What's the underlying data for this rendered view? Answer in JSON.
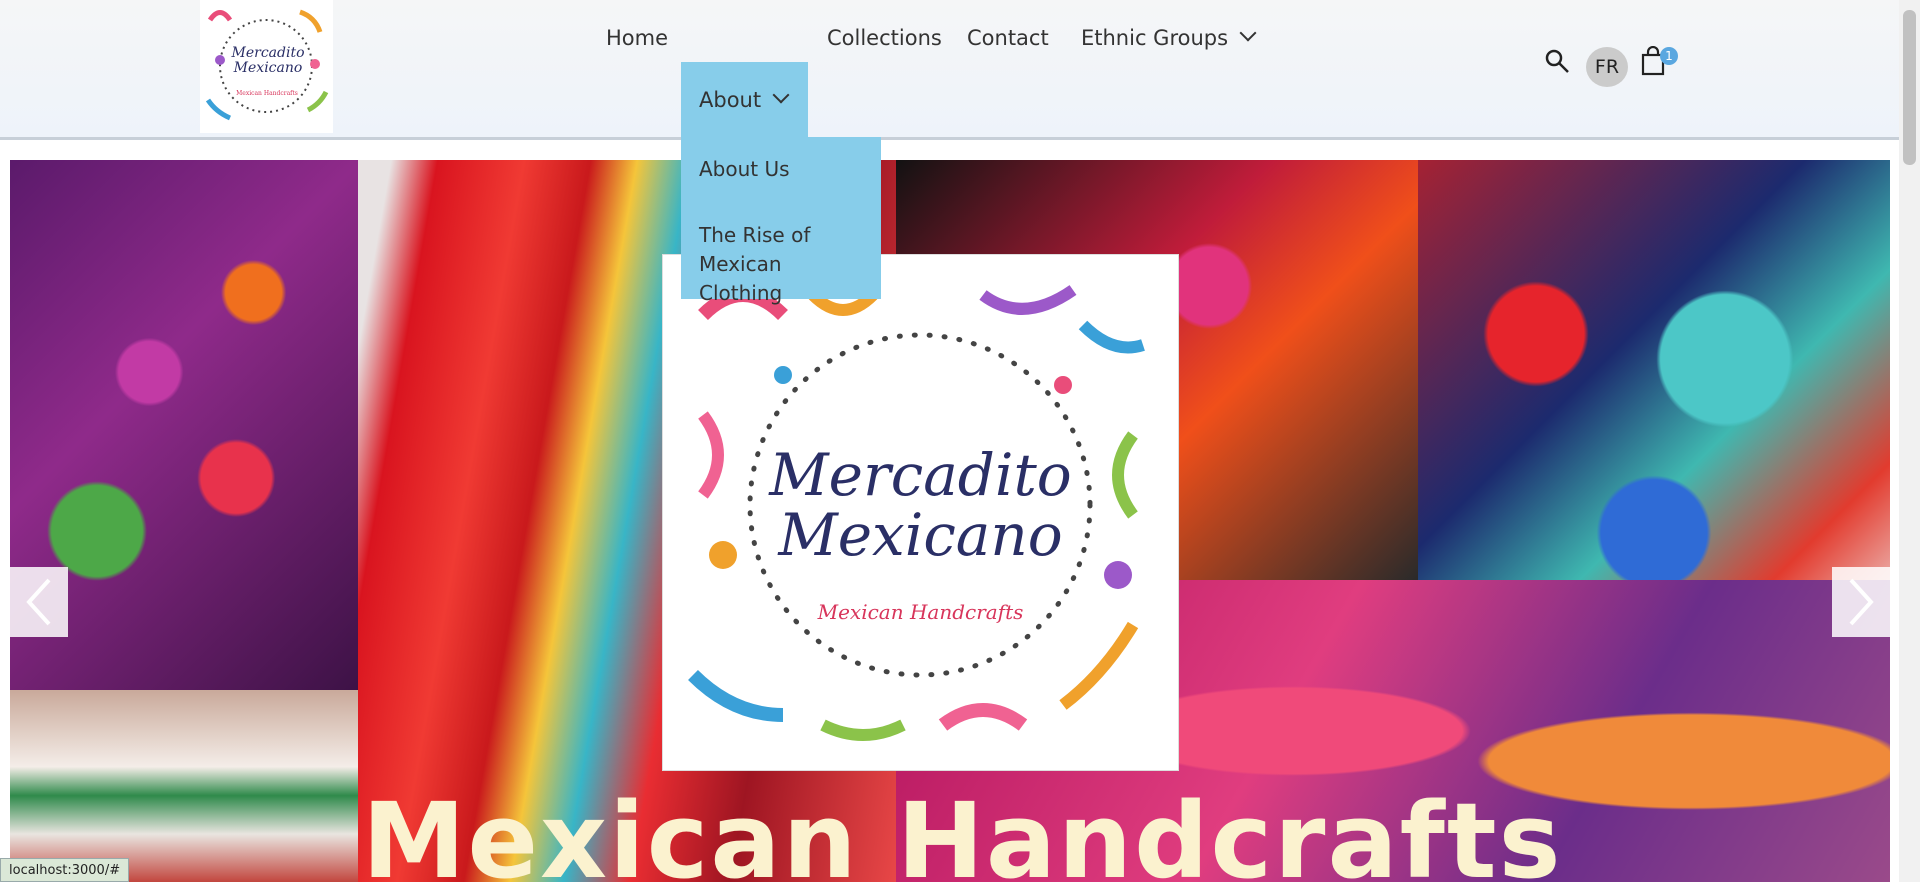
{
  "brand": {
    "logo_script": "Mercadito Mexicano",
    "logo_subtitle": "Mexican Handcrafts"
  },
  "nav": {
    "items": [
      {
        "label": "Home"
      },
      {
        "label": "About"
      },
      {
        "label": "Collections"
      },
      {
        "label": "Contact"
      },
      {
        "label": "Ethnic Groups"
      }
    ],
    "active": "About",
    "dropdown": [
      {
        "label": "About Us"
      },
      {
        "label": "The Rise of Mexican Clothing"
      }
    ]
  },
  "header_actions": {
    "search_icon": "search-icon",
    "language": "FR",
    "cart_icon": "shopping-bag-icon",
    "cart_count": "1"
  },
  "hero": {
    "title": "Mexican Handcrafts",
    "prev_icon": "chevron-left-icon",
    "next_icon": "chevron-right-icon"
  },
  "statusbar": {
    "url": "localhost:3000/#"
  },
  "colors": {
    "nav_active": "#87cdea",
    "badge": "#5aa7e0",
    "hero_title": "#fbf2cf"
  }
}
